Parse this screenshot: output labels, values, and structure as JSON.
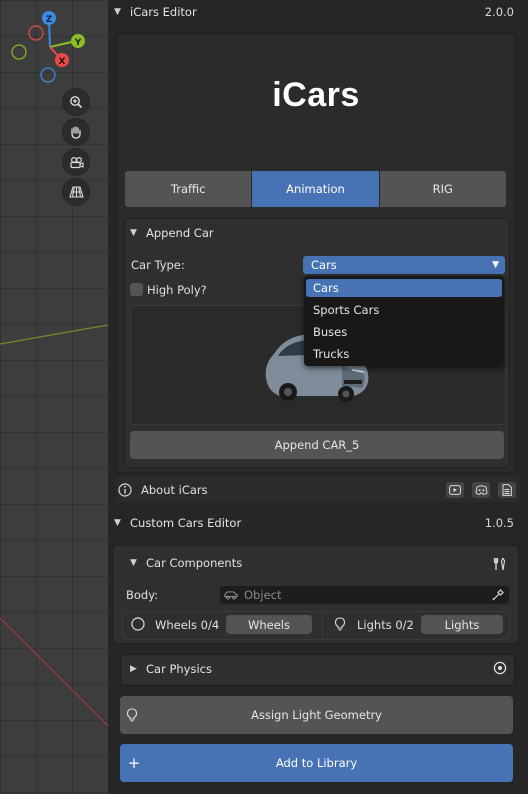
{
  "icars": {
    "header": "iCars Editor",
    "version": "2.0.0",
    "logo": "iCars",
    "tabs": [
      {
        "label": "Traffic",
        "active": false
      },
      {
        "label": "Animation",
        "active": true
      },
      {
        "label": "RIG",
        "active": false
      }
    ],
    "append_section": {
      "title": "Append Car",
      "car_type_label": "Car Type:",
      "car_type_value": "Cars",
      "high_poly_label": "High Poly?",
      "high_poly_checked": false,
      "dropdown_options": [
        "Cars",
        "Sports Cars",
        "Buses",
        "Trucks"
      ],
      "append_button": "Append CAR_5"
    },
    "about": {
      "label": "About iCars",
      "icons": [
        "youtube-icon",
        "discord-icon",
        "document-icon"
      ]
    }
  },
  "custom": {
    "header": "Custom Cars Editor",
    "version": "1.0.5",
    "components": {
      "title": "Car Components",
      "body_label": "Body:",
      "body_placeholder": "Object",
      "wheels_count": "Wheels 0/4",
      "wheels_button": "Wheels",
      "lights_count": "Lights 0/2",
      "lights_button": "Lights"
    },
    "physics_title": "Car Physics",
    "assign_button": "Assign Light Geometry",
    "add_library_button": "Add to Library"
  },
  "viewport": {
    "gizmo_axes": [
      "Z",
      "Y",
      "X"
    ]
  },
  "colors": {
    "accent": "#4772b3",
    "axis_x": "#e84a4a",
    "axis_y": "#8cbd28",
    "axis_z": "#3a8ce6"
  }
}
